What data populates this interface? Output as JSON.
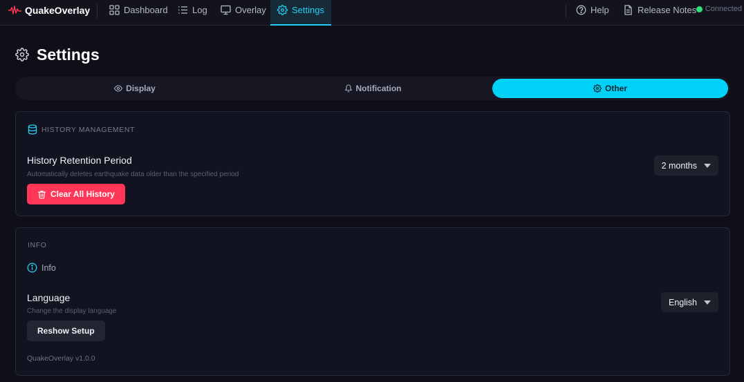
{
  "app": {
    "name": "QuakeOverlay"
  },
  "nav": {
    "items": [
      {
        "label": "Dashboard",
        "icon": "dashboard-grid-icon"
      },
      {
        "label": "Log",
        "icon": "list-icon"
      },
      {
        "label": "Overlay",
        "icon": "monitor-icon"
      },
      {
        "label": "Settings",
        "icon": "gear-icon",
        "active": true
      }
    ],
    "right": [
      {
        "label": "Help",
        "icon": "help-circle-icon"
      },
      {
        "label": "Release Notes",
        "icon": "document-icon"
      }
    ],
    "status": "Connected"
  },
  "page": {
    "title": "Settings"
  },
  "tabs": [
    {
      "label": "Display",
      "icon": "eye-icon"
    },
    {
      "label": "Notification",
      "icon": "bell-icon"
    },
    {
      "label": "Other",
      "icon": "gear-icon",
      "active": true
    }
  ],
  "history": {
    "section_label": "HISTORY MANAGEMENT",
    "title": "History Retention Period",
    "description": "Automatically deletes earthquake data older than the specified period",
    "retention_value": "2 months",
    "clear_label": "Clear All History"
  },
  "info": {
    "section_label": "INFO",
    "info_label": "Info",
    "language_title": "Language",
    "language_description": "Change the display language",
    "language_value": "English",
    "reshow_label": "Reshow Setup",
    "version": "QuakeOverlay v1.0.0"
  },
  "colors": {
    "accent": "#00d1f7",
    "danger": "#ff3656",
    "status_ok": "#2ee07a",
    "logo": "#ff3656"
  }
}
